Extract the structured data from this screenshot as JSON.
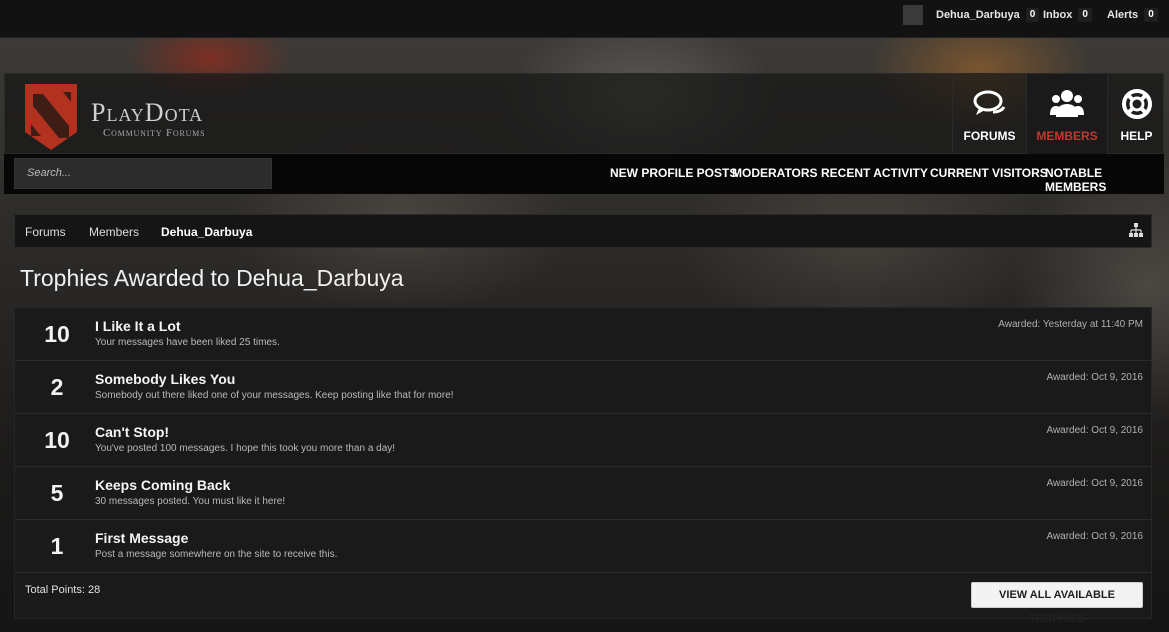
{
  "topbar": {
    "username": "Dehua_Darbuya",
    "user_count": "0",
    "inbox_label": "Inbox",
    "inbox_count": "0",
    "alerts_label": "Alerts",
    "alerts_count": "0"
  },
  "header": {
    "brand": "PlayDota",
    "subtitle": "Community Forums",
    "tabs": [
      {
        "label": "FORUMS",
        "icon": "chat-bubbles-icon"
      },
      {
        "label": "MEMBERS",
        "icon": "users-icon"
      },
      {
        "label": "HELP",
        "icon": "lifebuoy-icon"
      }
    ]
  },
  "subnav": {
    "search_placeholder": "Search...",
    "links": [
      "NEW PROFILE POSTS",
      "MODERATORS",
      "RECENT ACTIVITY",
      "CURRENT VISITORS",
      "NOTABLE MEMBERS"
    ]
  },
  "breadcrumb": [
    "Forums",
    "Members",
    "Dehua_Darbuya"
  ],
  "page_title": "Trophies Awarded to Dehua_Darbuya",
  "trophies": [
    {
      "points": "10",
      "name": "I Like It a Lot",
      "desc": "Your messages have been liked 25 times.",
      "date": "Awarded: Yesterday at 11:40 PM"
    },
    {
      "points": "2",
      "name": "Somebody Likes You",
      "desc": "Somebody out there liked one of your messages. Keep posting like that for more!",
      "date": "Awarded: Oct 9, 2016"
    },
    {
      "points": "10",
      "name": "Can't Stop!",
      "desc": "You've posted 100 messages. I hope this took you more than a day!",
      "date": "Awarded: Oct 9, 2016"
    },
    {
      "points": "5",
      "name": "Keeps Coming Back",
      "desc": "30 messages posted. You must like it here!",
      "date": "Awarded: Oct 9, 2016"
    },
    {
      "points": "1",
      "name": "First Message",
      "desc": "Post a message somewhere on the site to receive this.",
      "date": "Awarded: Oct 9, 2016"
    }
  ],
  "total_points": "Total Points: 28",
  "view_all_label": "VIEW ALL AVAILABLE TROPHIES",
  "colors": {
    "accent": "#c0392b",
    "background": "#141414"
  }
}
